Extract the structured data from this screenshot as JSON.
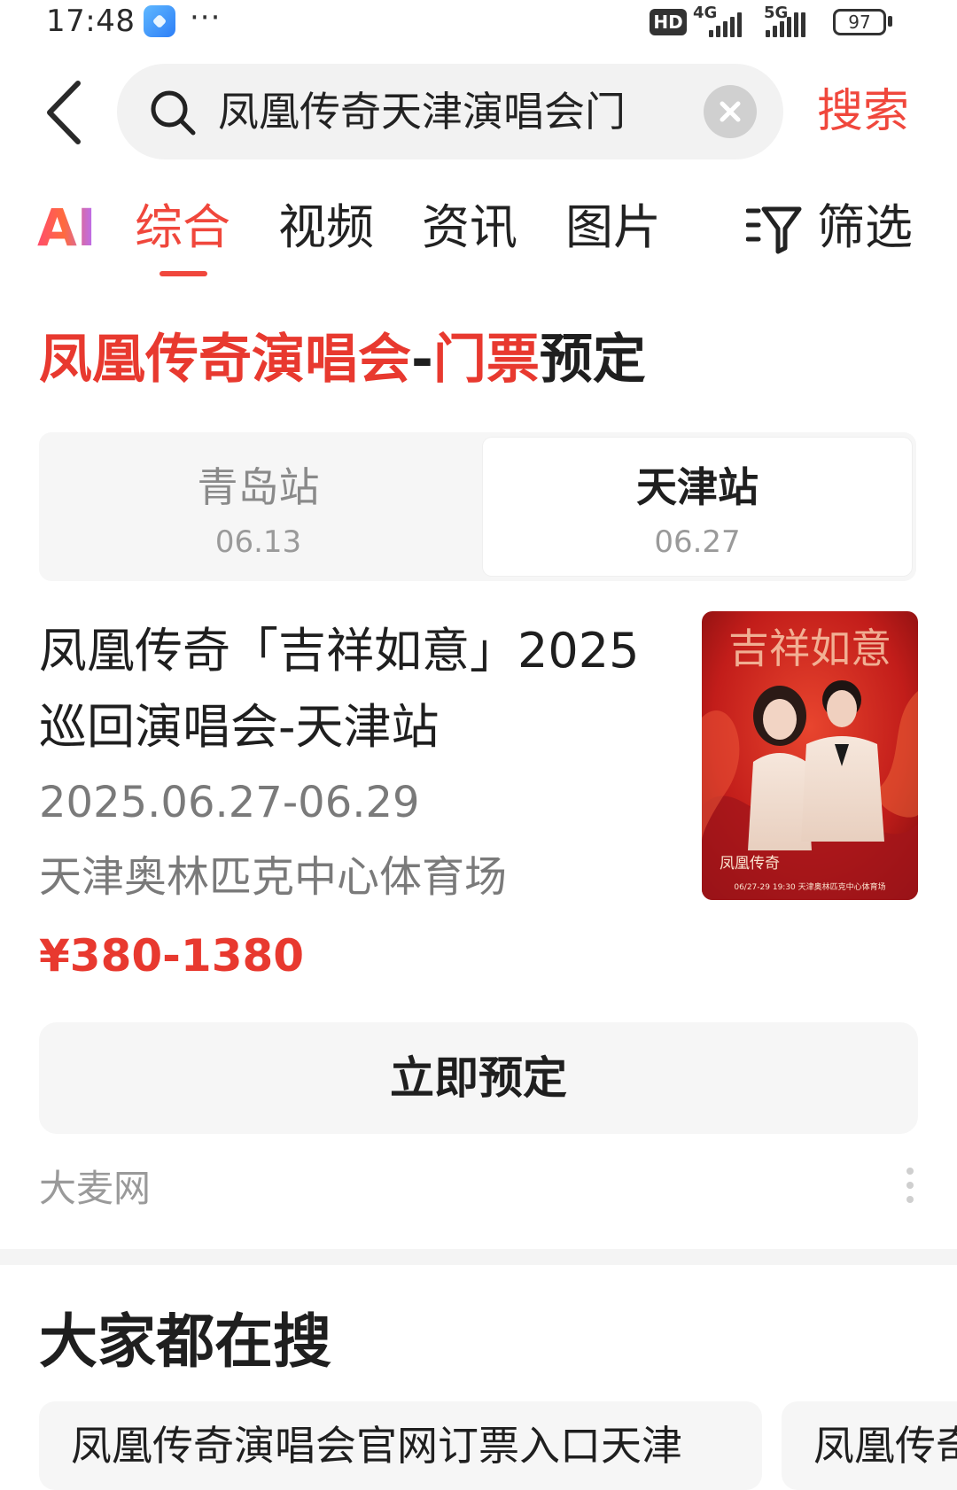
{
  "status_bar": {
    "time": "17:48",
    "more": "···",
    "hd_label": "HD",
    "network_1": "4G",
    "network_2": "5G",
    "battery": "97"
  },
  "search": {
    "query": "凤凰传奇天津演唱会门",
    "button_label": "搜索"
  },
  "tabs": {
    "ai_label": "AI",
    "items": [
      {
        "label": "综合",
        "active": true
      },
      {
        "label": "视频"
      },
      {
        "label": "资讯"
      },
      {
        "label": "图片"
      }
    ],
    "filter_label": "筛选"
  },
  "result": {
    "heading_red_1": "凤凰传奇演唱会",
    "heading_dash": "-",
    "heading_red_2": "门票",
    "heading_dark": "预定",
    "stations": [
      {
        "name": "青岛站",
        "date": "06.13",
        "selected": false
      },
      {
        "name": "天津站",
        "date": "06.27",
        "selected": true
      }
    ],
    "event": {
      "title_line1": "凤凰传奇「吉祥如意」2025",
      "title_line2": "巡回演唱会-天津站",
      "dates": "2025.06.27-06.29",
      "venue": "天津奥林匹克中心体育场",
      "price": "¥380-1380"
    },
    "poster": {
      "headline": "吉祥如意",
      "caption_name": "凤凰传奇",
      "caption_line": "06/27-29 19:30   天津奥林匹克中心体育场"
    },
    "book_button": "立即预定",
    "source": "大麦网"
  },
  "related": {
    "title": "大家都在搜",
    "chips": [
      "凤凰传奇演唱会官网订票入口天津",
      "凤凰传奇"
    ]
  },
  "colors": {
    "accent": "#f0473c",
    "price": "#e8392f",
    "muted": "#9a9a9a"
  }
}
